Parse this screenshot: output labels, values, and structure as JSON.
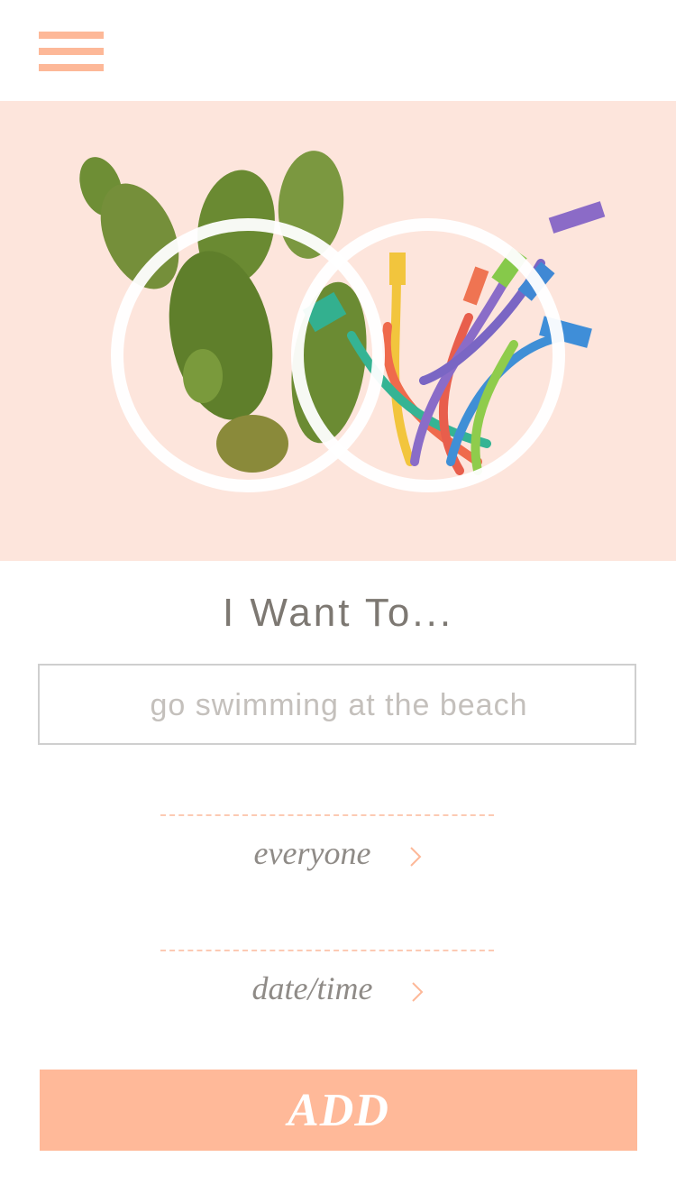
{
  "header": {
    "menu_icon": "hamburger-menu-icon"
  },
  "hero": {
    "image_description_icon": "cactus-and-network-cables-illustration"
  },
  "form": {
    "heading": "I Want To...",
    "activity_placeholder": "go swimming at the beach",
    "audience_label": "everyone",
    "datetime_label": "date/time",
    "add_label": "ADD"
  },
  "colors": {
    "accent": "#ffb999",
    "hero_background": "#fde5dc",
    "dashes": "#fccab3"
  }
}
